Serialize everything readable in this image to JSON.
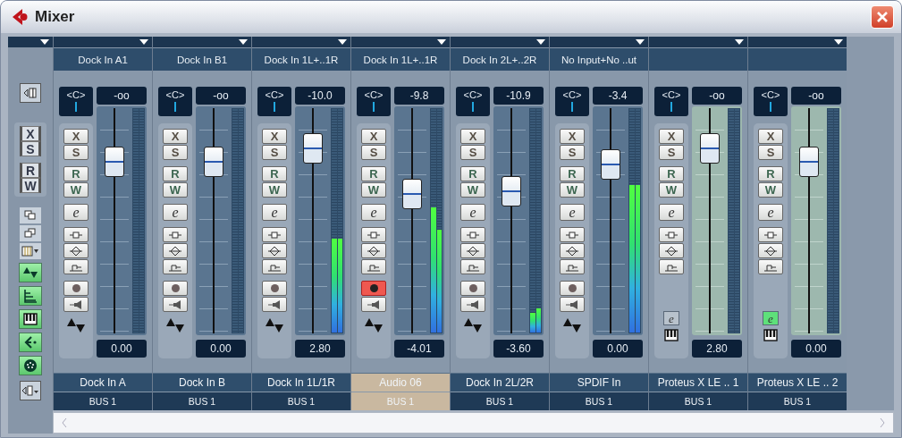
{
  "window": {
    "title": "Mixer"
  },
  "toolbar": {
    "buttons": [
      "X",
      "S",
      "R",
      "W"
    ]
  },
  "channels": [
    {
      "kind": "audio",
      "input": "Dock In A1",
      "pan": "<C>",
      "volume": "-oo",
      "buttons": [
        "X",
        "S",
        "R",
        "W",
        "e"
      ],
      "record": false,
      "level": 0.76,
      "gain": "0.00",
      "name": "Dock In A",
      "output": "BUS 1",
      "selected": false
    },
    {
      "kind": "audio",
      "input": "Dock In B1",
      "pan": "<C>",
      "volume": "-oo",
      "buttons": [
        "X",
        "S",
        "R",
        "W",
        "e"
      ],
      "record": false,
      "level": 0.76,
      "gain": "0.00",
      "name": "Dock In B",
      "output": "BUS 1",
      "selected": false
    },
    {
      "kind": "audio",
      "input": "Dock In 1L+..1R",
      "pan": "<C>",
      "volume": "-10.0",
      "buttons": [
        "X",
        "S",
        "R",
        "W",
        "e"
      ],
      "record": false,
      "level": 0.82,
      "meters": [
        {
          "level": 0.42
        },
        {
          "level": 0.42
        }
      ],
      "gain": "2.80",
      "name": "Dock In 1L/1R",
      "output": "BUS 1",
      "selected": false
    },
    {
      "kind": "audio",
      "input": "Dock In 1L+..1R",
      "pan": "<C>",
      "volume": "-9.8",
      "buttons": [
        "X",
        "S",
        "R",
        "W",
        "e"
      ],
      "record": true,
      "level": 0.62,
      "meters": [
        {
          "level": 0.56
        },
        {
          "level": 0.46
        }
      ],
      "gain": "-4.01",
      "name": "Audio 06",
      "output": "BUS 1",
      "selected": true
    },
    {
      "kind": "audio",
      "input": "Dock In 2L+..2R",
      "pan": "<C>",
      "volume": "-10.9",
      "buttons": [
        "X",
        "S",
        "R",
        "W",
        "e"
      ],
      "record": false,
      "level": 0.63,
      "meters": [
        {
          "level": 0.09
        },
        {
          "level": 0.11
        }
      ],
      "gain": "-3.60",
      "name": "Dock In 2L/2R",
      "output": "BUS 1",
      "selected": false
    },
    {
      "kind": "audio",
      "input": "No Input+No ..ut",
      "pan": "<C>",
      "volume": "-3.4",
      "buttons": [
        "X",
        "S",
        "R",
        "W",
        "e"
      ],
      "record": false,
      "level": 0.75,
      "meters": [
        {
          "level": 0.66
        },
        {
          "level": 0.66
        }
      ],
      "gain": "0.00",
      "name": "SPDIF In",
      "output": "BUS 1",
      "selected": false
    },
    {
      "kind": "instrument",
      "pan": "<C>",
      "volume": "-oo",
      "buttons": [
        "X",
        "S",
        "R",
        "W",
        "e"
      ],
      "instrument_edit": {
        "label": "e",
        "active": false
      },
      "level": 0.82,
      "gain": "2.80",
      "name": "Proteus X LE .. 1",
      "output": "BUS 1",
      "selected": false
    },
    {
      "kind": "instrument",
      "pan": "<C>",
      "volume": "-oo",
      "buttons": [
        "X",
        "S",
        "R",
        "W",
        "e"
      ],
      "instrument_edit": {
        "label": "e",
        "active": true
      },
      "level": 0.76,
      "gain": "0.00",
      "name": "Proteus X LE .. 2",
      "output": "BUS 1",
      "selected": false
    }
  ]
}
